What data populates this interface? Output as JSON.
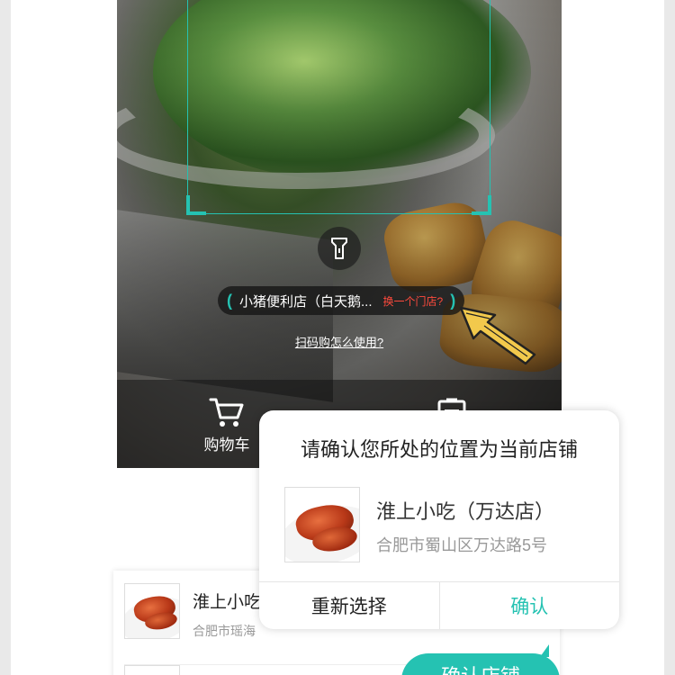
{
  "scanner": {
    "store_name": "小猪便利店（白天鹅...",
    "switch_store_label": "换一个门店?",
    "help_link": "扫码购怎么使用?",
    "accent_color": "#25c2b2",
    "icons": {
      "flashlight": "flashlight-icon",
      "pointer": "pointer-arrow-icon"
    }
  },
  "tabbar": {
    "cart_label": "购物车",
    "icons": {
      "cart": "cart-icon",
      "scan": "scan-icon"
    }
  },
  "store_list": {
    "items": [
      {
        "name": "淮上小吃",
        "address": "合肥市瑶海"
      },
      {
        "name": ""
      }
    ],
    "confirm_button": "确认店铺"
  },
  "dialog": {
    "title": "请确认您所处的位置为当前店铺",
    "store_name": "淮上小吃（万达店）",
    "store_address": "合肥市蜀山区万达路5号",
    "reselect_label": "重新选择",
    "confirm_label": "确认"
  }
}
